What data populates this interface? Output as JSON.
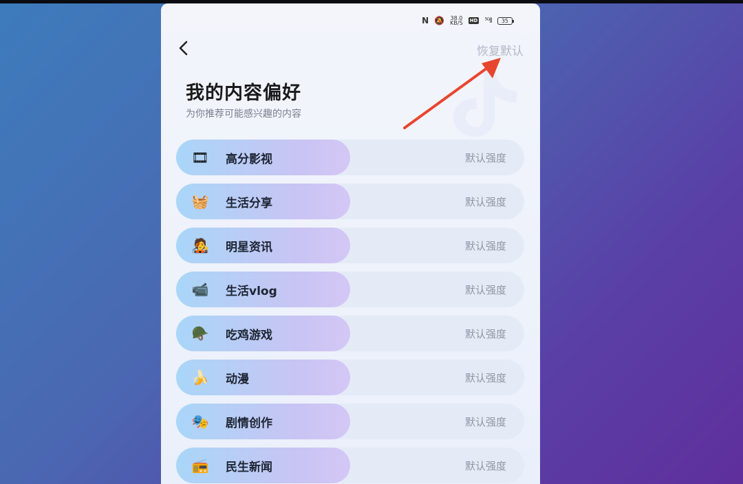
{
  "status_bar": {
    "nfc": "N",
    "mute": "🔕",
    "speed_value": "38.0",
    "speed_unit": "KB/S",
    "hd": "HD",
    "signal": "⁵ᴳll",
    "battery": "35"
  },
  "header": {
    "back_icon": "chevron-left-icon",
    "restore_label": "恢复默认"
  },
  "page": {
    "title": "我的内容偏好",
    "subtitle": "为你推荐可能感兴趣的内容"
  },
  "preferences": [
    {
      "icon": "film-icon",
      "glyph": "🎞",
      "label": "高分影视",
      "strength": "默认强度"
    },
    {
      "icon": "share-icon",
      "glyph": "🧺",
      "label": "生活分享",
      "strength": "默认强度"
    },
    {
      "icon": "star-person-icon",
      "glyph": "🧑‍🎤",
      "label": "明星资讯",
      "strength": "默认强度"
    },
    {
      "icon": "camera-icon",
      "glyph": "📹",
      "label": "生活vlog",
      "strength": "默认强度"
    },
    {
      "icon": "helmet-icon",
      "glyph": "🪖",
      "label": "吃鸡游戏",
      "strength": "默认强度"
    },
    {
      "icon": "anime-icon",
      "glyph": "🍌",
      "label": "动漫",
      "strength": "默认强度"
    },
    {
      "icon": "drama-icon",
      "glyph": "🎭",
      "label": "剧情创作",
      "strength": "默认强度"
    },
    {
      "icon": "news-icon",
      "glyph": "📻",
      "label": "民生新闻",
      "strength": "默认强度"
    }
  ],
  "colors": {
    "accent_arrow": "#e8452f",
    "pill_start": "#a9d6f8",
    "pill_end": "#d4c7f5",
    "row_bg": "#e4ebf7"
  }
}
